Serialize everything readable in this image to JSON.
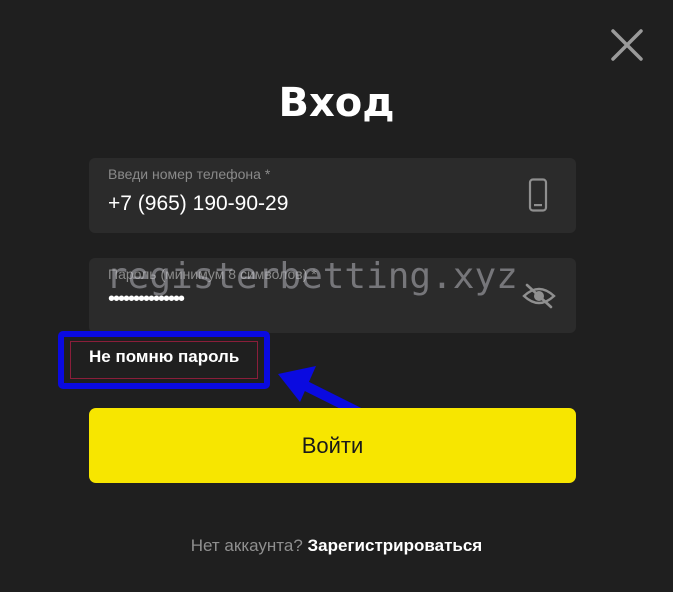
{
  "dialog": {
    "title": "Вход",
    "close_icon": "close-icon"
  },
  "phone": {
    "label": "Введи номер телефона *",
    "value": "+7 (965) 190-90-29",
    "icon": "phone-icon"
  },
  "password": {
    "label": "Пароль (минимум 8 символов) *",
    "value": "•••••••••••••••",
    "icon": "eye-off-icon"
  },
  "forgot": {
    "label": "Не помню пароль"
  },
  "login_button": {
    "label": "Войти",
    "color": "#f7e600"
  },
  "footer": {
    "no_account": "Нет аккаунта?",
    "register": "Зарегистрироваться"
  },
  "watermark": {
    "text": "registerbetting.xyz"
  },
  "annotation": {
    "highlight_color": "#0a0ae0",
    "arrow_color": "#0a0ae0"
  }
}
